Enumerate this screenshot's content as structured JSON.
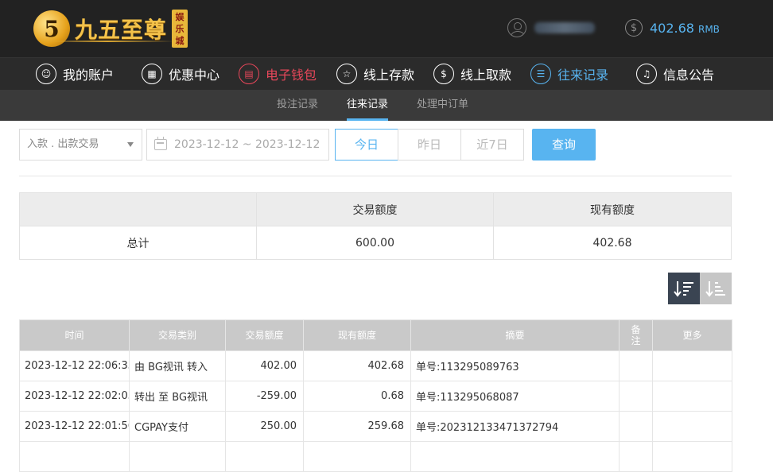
{
  "brand": {
    "badge": "5",
    "name": "九五至尊",
    "tag": "娱乐城"
  },
  "account": {
    "balance": "402.68",
    "currency": "RMB"
  },
  "main_nav": [
    {
      "label": "我的账户",
      "icon": "user-icon",
      "state": "normal"
    },
    {
      "label": "优惠中心",
      "icon": "gift-icon",
      "state": "normal"
    },
    {
      "label": "电子钱包",
      "icon": "wallet-icon",
      "state": "highlight-red"
    },
    {
      "label": "线上存款",
      "icon": "deposit-icon",
      "state": "normal"
    },
    {
      "label": "线上取款",
      "icon": "withdraw-icon",
      "state": "normal"
    },
    {
      "label": "往来记录",
      "icon": "records-icon",
      "state": "active"
    },
    {
      "label": "信息公告",
      "icon": "bell-icon",
      "state": "normal"
    }
  ],
  "sub_nav": [
    {
      "label": "投注记录",
      "active": false
    },
    {
      "label": "往来记录",
      "active": true
    },
    {
      "label": "处理中订单",
      "active": false
    }
  ],
  "filters": {
    "type_select": "入款 . 出款交易",
    "date_range": "2023-12-12 ~ 2023-12-12",
    "quick": [
      {
        "label": "今日",
        "active": true
      },
      {
        "label": "昨日",
        "active": false
      },
      {
        "label": "近7日",
        "active": false
      }
    ],
    "query_label": "查询"
  },
  "summary": {
    "headers": [
      "",
      "交易额度",
      "现有额度"
    ],
    "row": [
      "总计",
      "600.00",
      "402.68"
    ]
  },
  "records": {
    "headers": [
      "时间",
      "交易类别",
      "交易额度",
      "现有额度",
      "摘要",
      "备注",
      "更多"
    ],
    "rows": [
      [
        "2023-12-12 22:06:33",
        "由 BG视讯 转入",
        "402.00",
        "402.68",
        "单号:113295089763",
        "",
        ""
      ],
      [
        "2023-12-12 22:02:05",
        "转出 至 BG视讯",
        "-259.00",
        "0.68",
        "单号:113295068087",
        "",
        ""
      ],
      [
        "2023-12-12 22:01:56",
        "CGPAY支付",
        "250.00",
        "259.68",
        "单号:202312133471372794",
        "",
        ""
      ],
      [
        "",
        "",
        "",
        "",
        "",
        "",
        ""
      ]
    ]
  },
  "colors": {
    "accent_blue": "#58b4f0",
    "accent_red": "#e8475a",
    "topbar": "#222222"
  }
}
